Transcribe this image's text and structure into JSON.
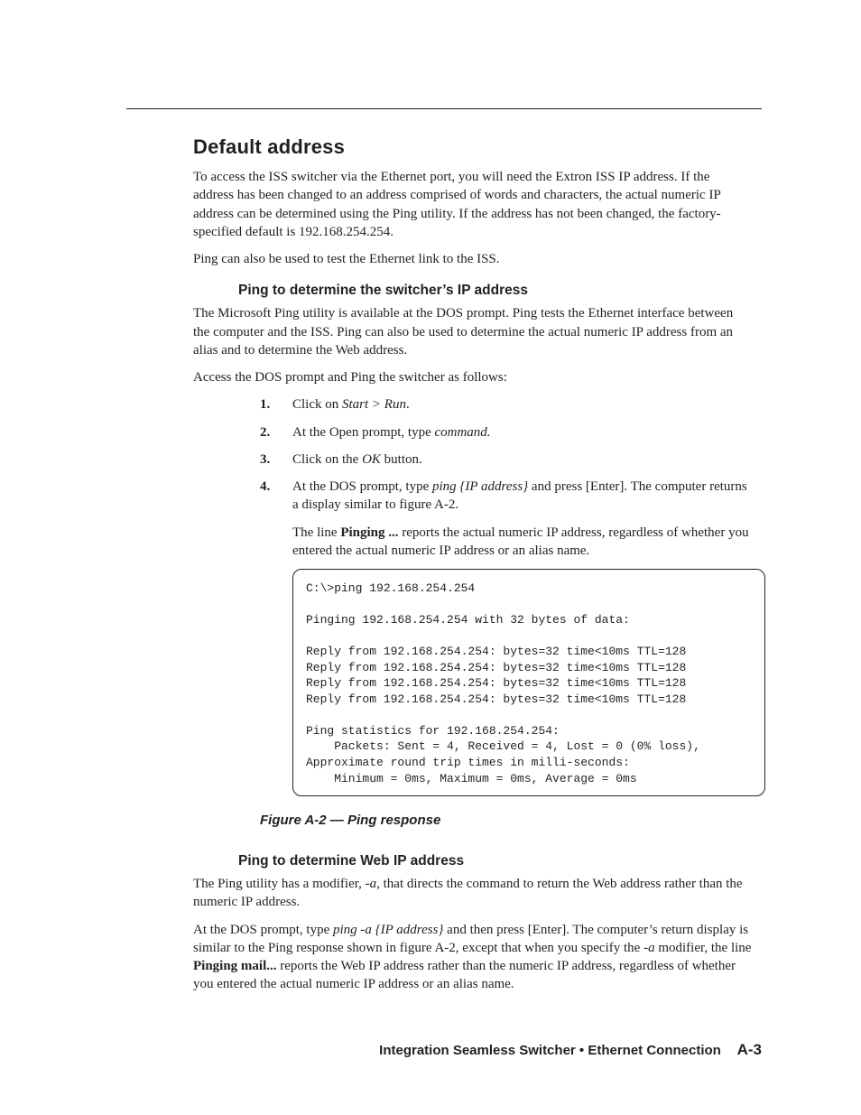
{
  "heading_main": "Default address",
  "intro_p1": "To access the ISS switcher via the Ethernet port, you will need the Extron ISS IP address.  If the address has been changed to an address comprised of words and characters, the actual numeric IP address can be determined using the Ping utility.  If the address has not been changed, the factory-specified default is 192.168.254.254.",
  "intro_p2": "Ping can also be used to test the Ethernet link to the ISS.",
  "sub1_heading": "Ping to determine the switcher’s IP address",
  "sub1_p1": "The Microsoft Ping utility is available at the DOS prompt.  Ping tests the Ethernet interface between the computer and the ISS.  Ping can also be used to determine the actual numeric IP address from an alias and to determine the Web address.",
  "sub1_p2": "Access the DOS prompt and Ping the switcher as follows:",
  "steps": {
    "s1": {
      "num": "1",
      "pre": "Click on ",
      "em": "Start > Run",
      "post": "."
    },
    "s2": {
      "num": "2",
      "pre": "At the Open prompt, type ",
      "em": "command.",
      "post": ""
    },
    "s3": {
      "num": "3",
      "pre": "Click on the ",
      "em": "OK",
      "post": " button."
    },
    "s4": {
      "num": "4",
      "pre": "At the DOS prompt, type ",
      "em": "ping {IP address}",
      "post": " and press [Enter].  The computer returns a display similar to figure A-2."
    }
  },
  "sub_line_pre": "The line ",
  "sub_line_bold": "Pinging ...",
  "sub_line_post": " reports the actual numeric IP address, regardless of whether you entered the actual numeric IP address or an alias name.",
  "code_block": "C:\\>ping 192.168.254.254\n\nPinging 192.168.254.254 with 32 bytes of data:\n\nReply from 192.168.254.254: bytes=32 time<10ms TTL=128\nReply from 192.168.254.254: bytes=32 time<10ms TTL=128\nReply from 192.168.254.254: bytes=32 time<10ms TTL=128\nReply from 192.168.254.254: bytes=32 time<10ms TTL=128\n\nPing statistics for 192.168.254.254:\n    Packets: Sent = 4, Received = 4, Lost = 0 (0% loss),\nApproximate round trip times in milli-seconds:\n    Minimum = 0ms, Maximum = 0ms, Average = 0ms",
  "fig_caption": "Figure A-2 — Ping response",
  "sub2_heading": "Ping to determine Web IP address",
  "sub2_p1_pre": "The Ping utility has a modifier, ",
  "sub2_p1_em": "-a",
  "sub2_p1_post": ", that directs the command to return the Web address rather than the numeric IP address.",
  "sub2_p2_a": "At the DOS prompt, type ",
  "sub2_p2_em1": "ping -a {IP address}",
  "sub2_p2_b": " and then press [Enter].  The computer’s return display is similar to the Ping response shown in figure A-2, except that when you specify the ",
  "sub2_p2_em2": "-a",
  "sub2_p2_c": " modifier, the line ",
  "sub2_p2_bold": "Pinging mail...",
  "sub2_p2_d": " reports the Web IP address rather than the numeric IP address, regardless of whether you entered the actual numeric IP address or an alias name.",
  "footer_title": "Integration Seamless Switcher • Ethernet Connection",
  "footer_page": "A-3"
}
